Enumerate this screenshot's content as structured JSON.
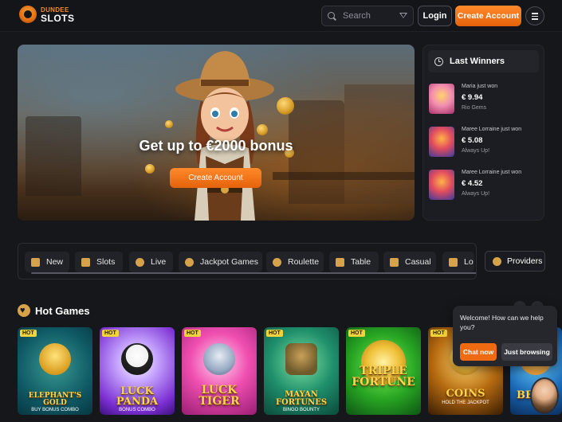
{
  "header": {
    "logo_top": "DUNDEE",
    "logo_bottom": "SLOTS",
    "search_placeholder": "Search",
    "login_label": "Login",
    "create_account_label": "Create Account",
    "icons": [
      "search-icon",
      "filter-icon",
      "hamburger-menu-icon"
    ]
  },
  "hero": {
    "title": "Get up to €2000 bonus",
    "cta_label": "Create Account"
  },
  "winners": {
    "title": "Last Winners",
    "items": [
      {
        "name": "Maria just won",
        "amount": "€ 9.94",
        "game": "Rio Gems"
      },
      {
        "name": "Maree Lorraine just won",
        "amount": "€ 5.08",
        "game": "Always Up!"
      },
      {
        "name": "Maree Lorraine just won",
        "amount": "€ 4.52",
        "game": "Always Up!"
      }
    ]
  },
  "categories": {
    "items": [
      {
        "label": "New",
        "icon": "new-icon"
      },
      {
        "label": "Slots",
        "icon": "slots-icon"
      },
      {
        "label": "Live",
        "icon": "live-icon"
      },
      {
        "label": "Jackpot Games",
        "icon": "jackpot-icon"
      },
      {
        "label": "Roulette",
        "icon": "roulette-icon"
      },
      {
        "label": "Table",
        "icon": "table-icon"
      },
      {
        "label": "Casual",
        "icon": "casual-icon"
      },
      {
        "label": "Lo",
        "icon": "lobby-icon"
      }
    ],
    "providers_label": "Providers"
  },
  "hot_games": {
    "title": "Hot Games",
    "badge": "HOT",
    "items": [
      {
        "title": "ELEPHANT'S GOLD",
        "sub": "BUY BONUS COMBO"
      },
      {
        "title": "LUCK PANDA",
        "sub": "BONUS COMBO"
      },
      {
        "title": "LUCK TIGER",
        "sub": ""
      },
      {
        "title": "MAYAN FORTUNES",
        "sub": "BINGO BOUNTY"
      },
      {
        "title": "TRIPLE FORTUNE",
        "sub": ""
      },
      {
        "title": "COINS",
        "sub": "HOLD THE JACKPOT"
      },
      {
        "title": "BEI FO",
        "sub": ""
      }
    ]
  },
  "chat": {
    "message": "Welcome! How can we help you?",
    "primary_label": "Chat now",
    "secondary_label": "Just browsing"
  },
  "colors": {
    "background": "#16171b",
    "accent_orange": "#f06a12",
    "gold": "#d7a34a",
    "hot_badge": "#f3d33a"
  }
}
